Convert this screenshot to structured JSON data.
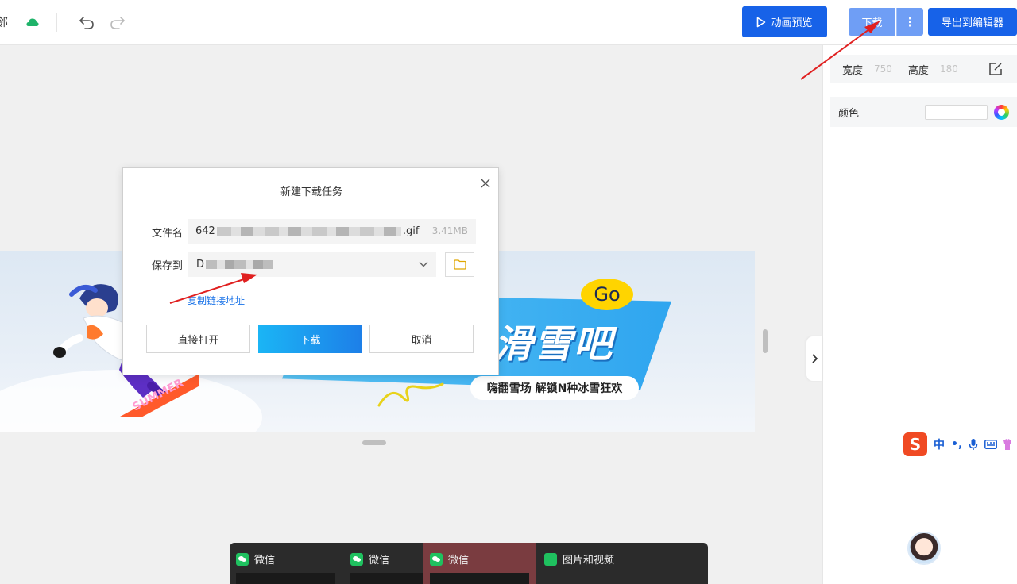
{
  "topbar": {
    "title_fragment": "邻",
    "preview_label": "动画预览",
    "download_label": "下载",
    "more_label": "⋮",
    "export_label": "导出到编辑器"
  },
  "panel": {
    "width_label": "宽度",
    "width_value": "750",
    "height_label": "高度",
    "height_value": "180",
    "color_label": "颜色"
  },
  "banner": {
    "go_text": "Go",
    "headline": "滑雪吧",
    "pill_text": "嗨翻雪场 解锁N种冰雪狂欢",
    "board_text": "SUMMER"
  },
  "dialog": {
    "title": "新建下载任务",
    "filename_label": "文件名",
    "filename_prefix": "642",
    "filename_ext": ".gif",
    "filesize": "3.41MB",
    "saveto_label": "保存到",
    "saveto_prefix": "D",
    "copy_link": "复制链接地址",
    "open_button": "直接打开",
    "download_button": "下载",
    "cancel_button": "取消"
  },
  "ime": {
    "logo": "S",
    "mode": "中",
    "punct": "•,"
  },
  "taskbar": {
    "items": [
      {
        "label": "微信"
      },
      {
        "label": "微信"
      },
      {
        "label": "微信"
      },
      {
        "label": "图片和视频"
      }
    ]
  }
}
